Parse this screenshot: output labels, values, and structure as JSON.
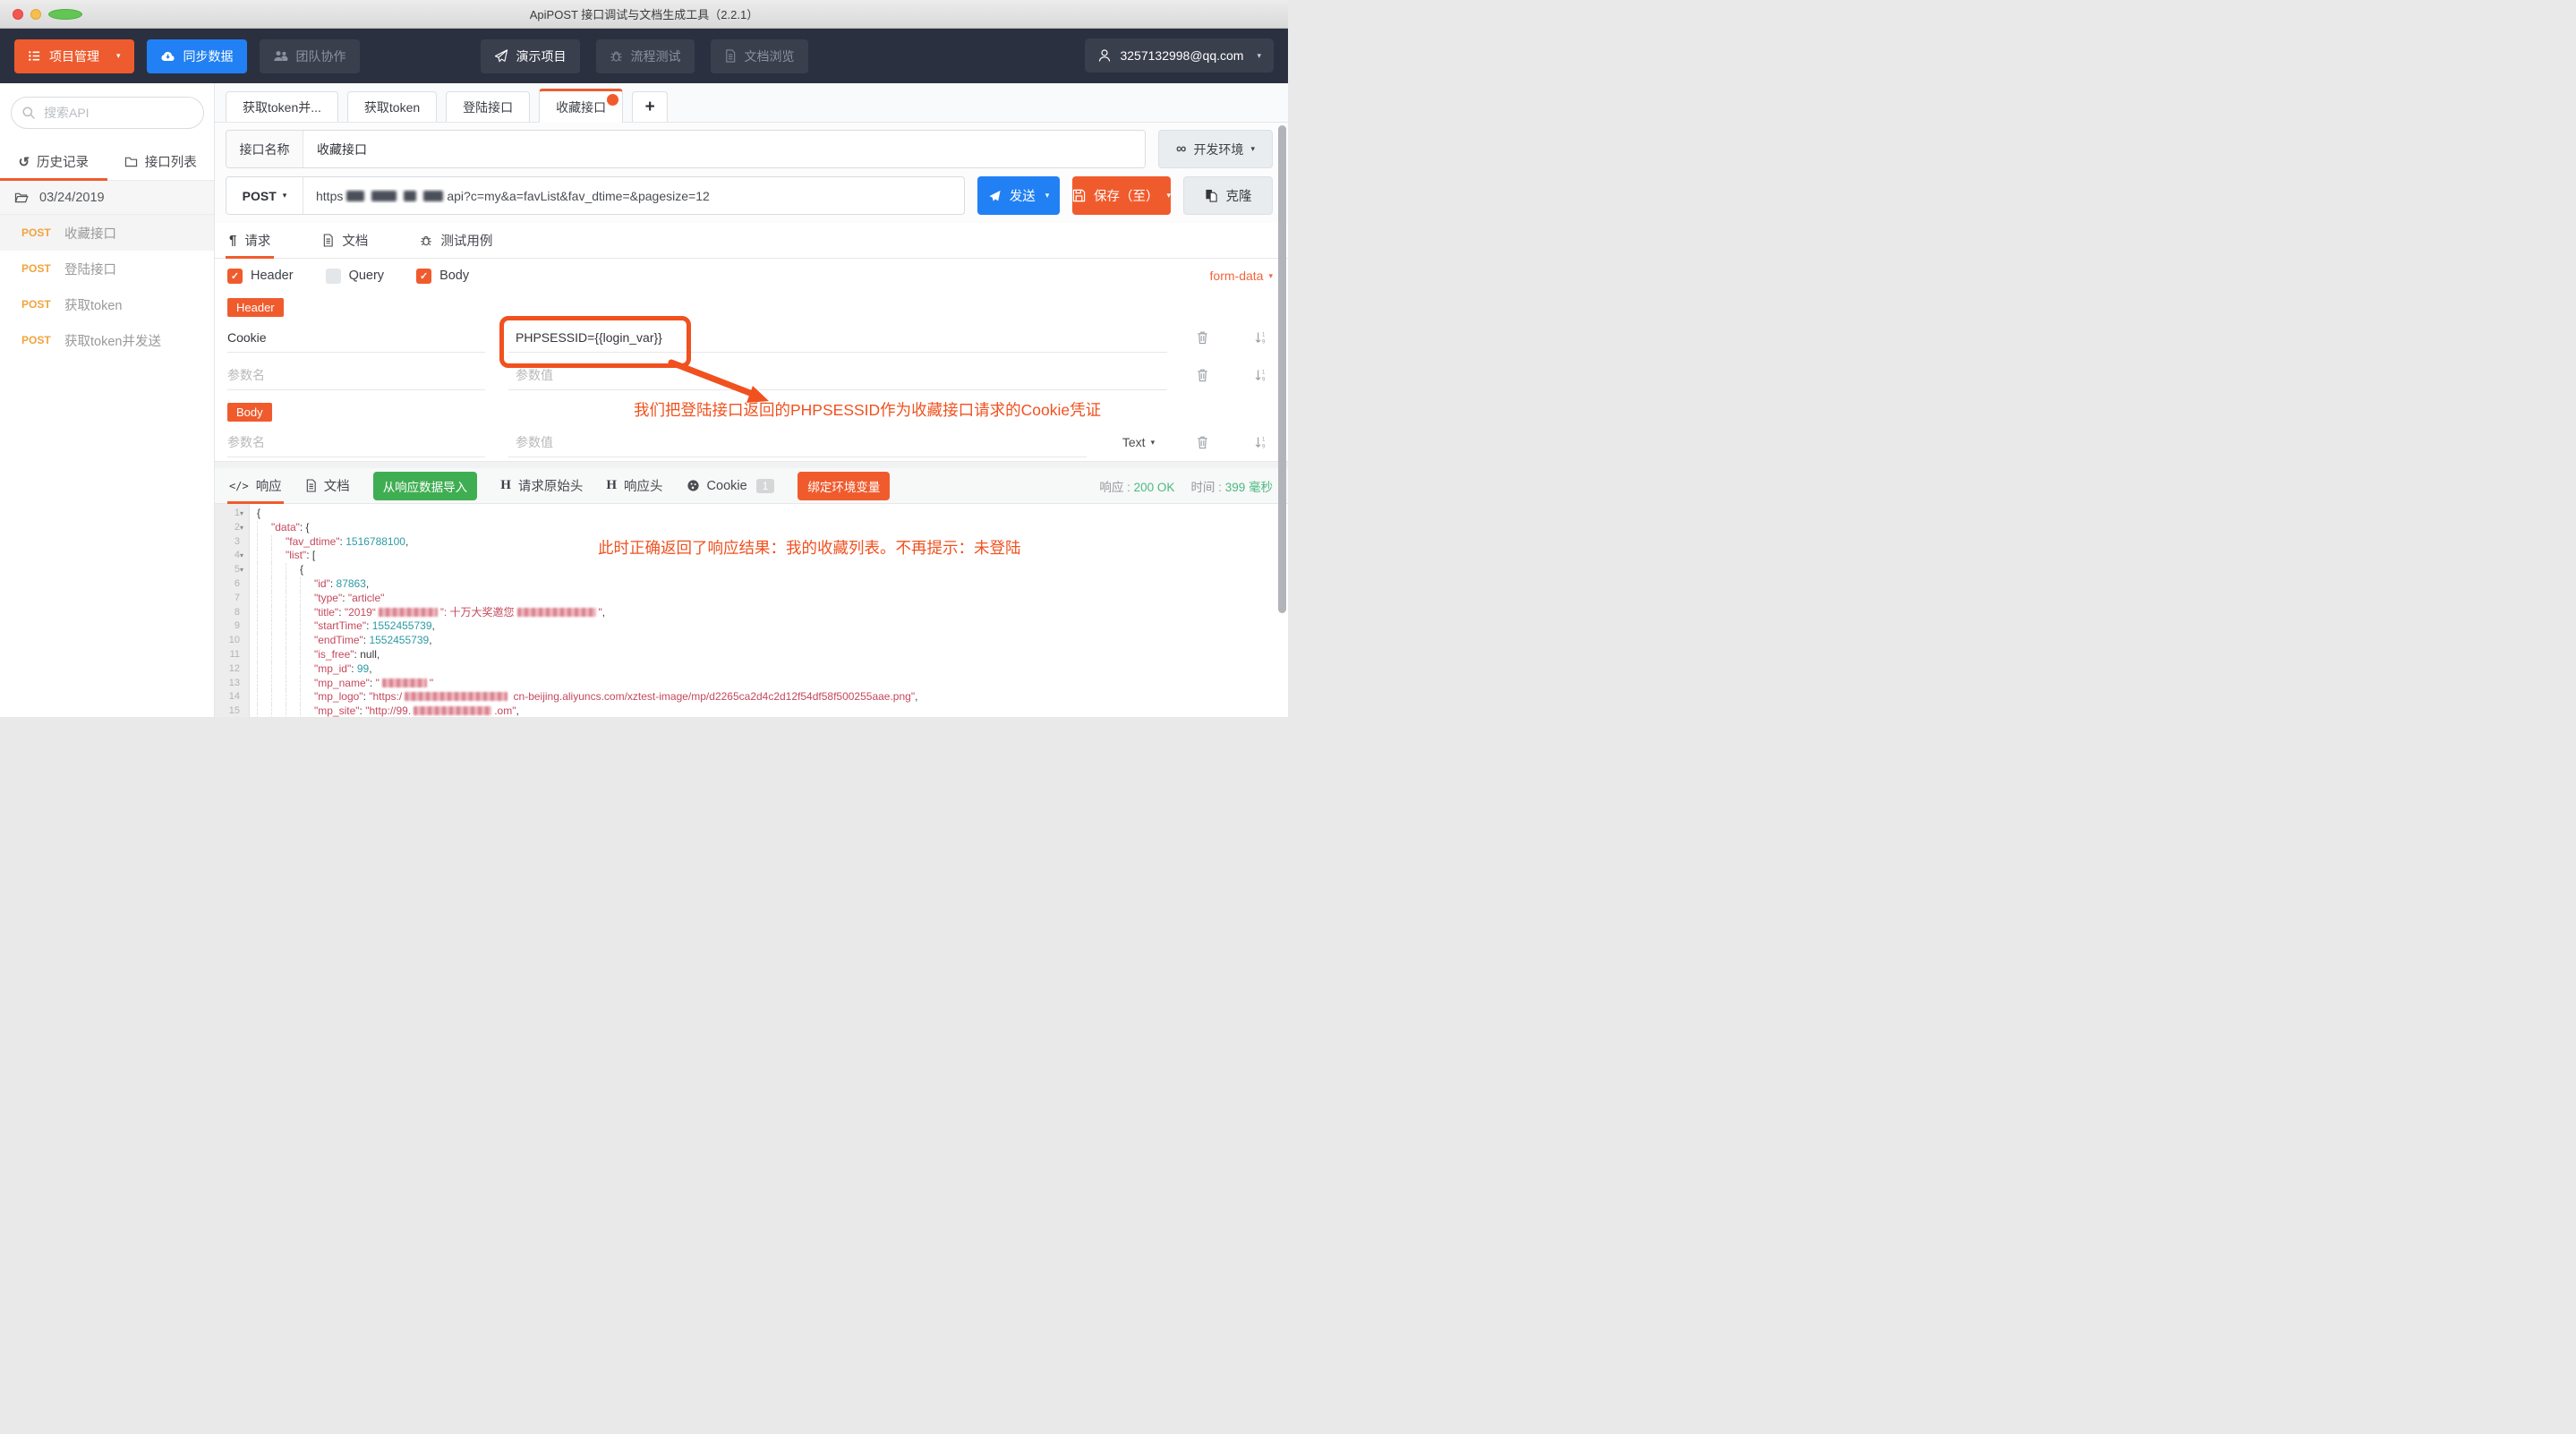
{
  "window_title": "ApiPOST 接口调试与文档生成工具（2.2.1）",
  "icons": {
    "pilcrow": "¶",
    "h": "H",
    "code": "</>",
    "infinity": "∞",
    "history": "↺"
  },
  "topbar": {
    "project": "项目管理",
    "sync": "同步数据",
    "team": "团队协作",
    "demo": "演示项目",
    "flow": "流程测试",
    "docs": "文档浏览",
    "user": "3257132998@qq.com"
  },
  "sidebar": {
    "search_placeholder": "搜索API",
    "tab_history": "历史记录",
    "tab_list": "接口列表",
    "date_group": "03/24/2019",
    "items": [
      {
        "method": "POST",
        "name": "收藏接口"
      },
      {
        "method": "POST",
        "name": "登陆接口"
      },
      {
        "method": "POST",
        "name": "获取token"
      },
      {
        "method": "POST",
        "name": "获取token并发送"
      }
    ]
  },
  "doc_tabs": {
    "items": [
      {
        "label": "获取token并..."
      },
      {
        "label": "获取token"
      },
      {
        "label": "登陆接口"
      },
      {
        "label": "收藏接口"
      }
    ],
    "add": "+"
  },
  "api": {
    "name_label": "接口名称",
    "name_value": "收藏接口",
    "env": "开发环境",
    "method": "POST",
    "url_prefix": "https",
    "url_suffix": "api?c=my&a=favList&fav_dtime=&pagesize=12",
    "send": "发送",
    "save": "保存（至）",
    "clone": "克隆"
  },
  "request": {
    "tab_request": "请求",
    "tab_doc": "文档",
    "tab_testcase": "测试用例",
    "cb_header": "Header",
    "cb_query": "Query",
    "cb_body": "Body",
    "format": "form-data",
    "header_badge": "Header",
    "cookie_key": "Cookie",
    "cookie_value": "PHPSESSID={{login_var}}",
    "ph_name": "参数名",
    "ph_value": "参数值",
    "body_badge": "Body",
    "body_type": "Text",
    "annotation": "我们把登陆接口返回的PHPSESSID作为收藏接口请求的Cookie凭证"
  },
  "response": {
    "tab_response": "响应",
    "tab_doc": "文档",
    "btn_import": "从响应数据导入",
    "tab_raw_request": "请求原始头",
    "tab_headers": "响应头",
    "tab_cookie": "Cookie",
    "cookie_count": "1",
    "btn_bind_env": "绑定环境变量",
    "status_label": "响应 :",
    "status_value": "200 OK",
    "time_label": "时间 :",
    "time_value": "399 毫秒",
    "annotation": "此时正确返回了响应结果：我的收藏列表。不再提示：未登陆",
    "code": {
      "lines": [
        {
          "n": 1,
          "fold": true,
          "ind": 0,
          "tokens": [
            [
              "p",
              "{"
            ]
          ]
        },
        {
          "n": 2,
          "fold": true,
          "ind": 1,
          "tokens": [
            [
              "k",
              "\"data\""
            ],
            [
              "p",
              ": {"
            ]
          ]
        },
        {
          "n": 3,
          "fold": false,
          "ind": 2,
          "tokens": [
            [
              "k",
              "\"fav_dtime\""
            ],
            [
              "p",
              ": "
            ],
            [
              "n",
              "1516788100"
            ],
            [
              "p",
              ","
            ]
          ]
        },
        {
          "n": 4,
          "fold": true,
          "ind": 2,
          "tokens": [
            [
              "k",
              "\"list\""
            ],
            [
              "p",
              ": ["
            ]
          ]
        },
        {
          "n": 5,
          "fold": true,
          "ind": 3,
          "tokens": [
            [
              "p",
              "{"
            ]
          ]
        },
        {
          "n": 6,
          "fold": false,
          "ind": 4,
          "tokens": [
            [
              "k",
              "\"id\""
            ],
            [
              "p",
              ": "
            ],
            [
              "n",
              "87863"
            ],
            [
              "p",
              ","
            ]
          ]
        },
        {
          "n": 7,
          "fold": false,
          "ind": 4,
          "tokens": [
            [
              "k",
              "\"type\""
            ],
            [
              "p",
              ": "
            ],
            [
              "s",
              "\"article\""
            ]
          ]
        },
        {
          "n": 8,
          "fold": false,
          "ind": 4,
          "tokens": [
            [
              "k",
              "\"title\""
            ],
            [
              "p",
              ": "
            ],
            [
              "s",
              "\"2019“"
            ],
            [
              "x",
              66
            ],
            [
              "s",
              "”: 十万大奖邀您"
            ],
            [
              "x",
              88
            ],
            [
              "s",
              "\""
            ],
            [
              "p",
              ","
            ]
          ]
        },
        {
          "n": 9,
          "fold": false,
          "ind": 4,
          "tokens": [
            [
              "k",
              "\"startTime\""
            ],
            [
              "p",
              ": "
            ],
            [
              "n",
              "1552455739"
            ],
            [
              "p",
              ","
            ]
          ]
        },
        {
          "n": 10,
          "fold": false,
          "ind": 4,
          "tokens": [
            [
              "k",
              "\"endTime\""
            ],
            [
              "p",
              ": "
            ],
            [
              "n",
              "1552455739"
            ],
            [
              "p",
              ","
            ]
          ]
        },
        {
          "n": 11,
          "fold": false,
          "ind": 4,
          "tokens": [
            [
              "k",
              "\"is_free\""
            ],
            [
              "p",
              ": "
            ],
            [
              "u",
              "null"
            ],
            [
              "p",
              ","
            ]
          ]
        },
        {
          "n": 12,
          "fold": false,
          "ind": 4,
          "tokens": [
            [
              "k",
              "\"mp_id\""
            ],
            [
              "p",
              ": "
            ],
            [
              "n",
              "99"
            ],
            [
              "p",
              ","
            ]
          ]
        },
        {
          "n": 13,
          "fold": false,
          "ind": 4,
          "tokens": [
            [
              "k",
              "\"mp_name\""
            ],
            [
              "p",
              ": "
            ],
            [
              "s",
              "\""
            ],
            [
              "x",
              50
            ],
            [
              "s",
              "\""
            ]
          ]
        },
        {
          "n": 14,
          "fold": false,
          "ind": 4,
          "tokens": [
            [
              "k",
              "\"mp_logo\""
            ],
            [
              "p",
              ": "
            ],
            [
              "s",
              "\"https:/"
            ],
            [
              "x",
              115
            ],
            [
              "s",
              " cn-beijing.aliyuncs.com/xztest-image/mp/d2265ca2d4c2d12f54df58f500255aae.png\""
            ],
            [
              "p",
              ","
            ]
          ]
        },
        {
          "n": 15,
          "fold": false,
          "ind": 4,
          "tokens": [
            [
              "k",
              "\"mp_site\""
            ],
            [
              "p",
              ": "
            ],
            [
              "s",
              "\"http://99."
            ],
            [
              "x",
              87
            ],
            [
              "s",
              ".om\""
            ],
            [
              "p",
              ","
            ]
          ]
        }
      ]
    }
  }
}
